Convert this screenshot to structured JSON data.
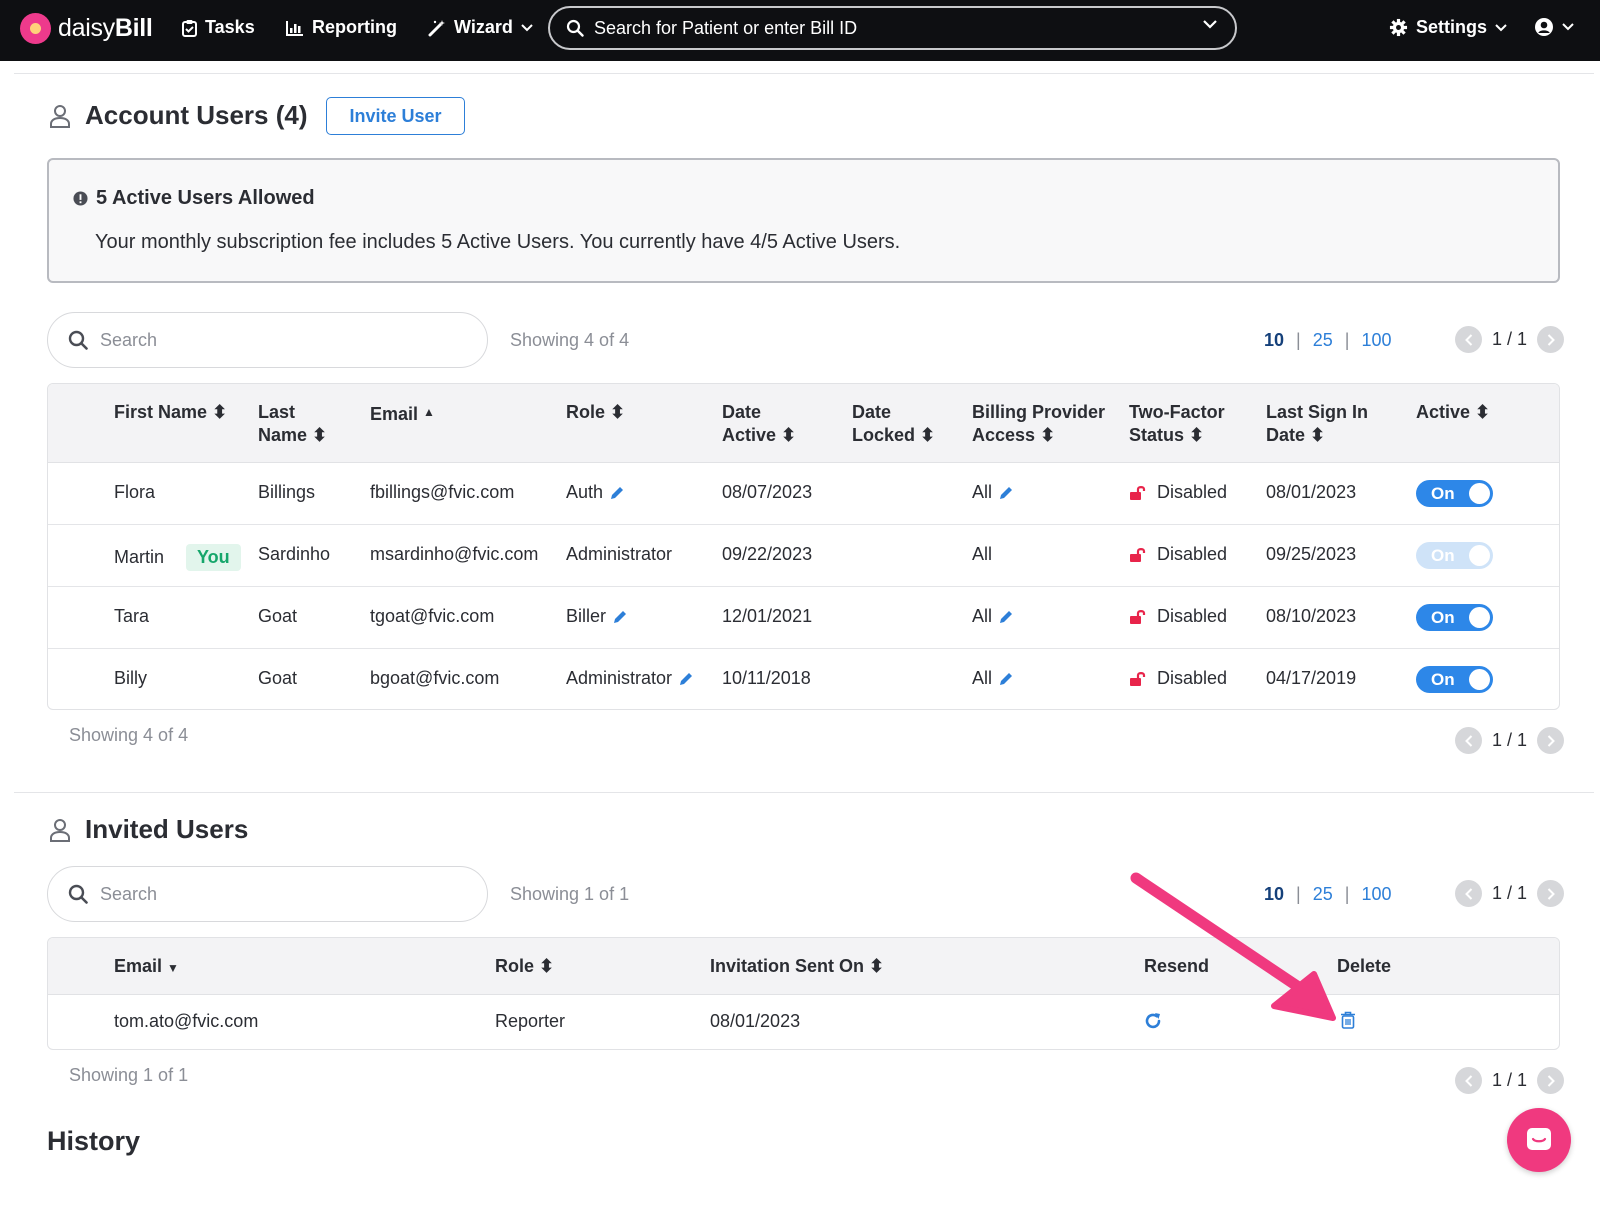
{
  "app": {
    "logo_text_light": "daisy",
    "logo_text_bold": "Bill",
    "nav": {
      "tasks": "Tasks",
      "reporting": "Reporting",
      "wizard": "Wizard",
      "settings": "Settings"
    },
    "search_placeholder": "Search for Patient or enter Bill ID"
  },
  "account_users": {
    "title": "Account Users (4)",
    "invite_label": "Invite User",
    "notice_title": "5 Active Users Allowed",
    "notice_body": "Your monthly subscription fee includes 5 Active Users. You currently have 4/5 Active Users.",
    "search_placeholder": "Search",
    "showing_top": "Showing 4 of 4",
    "showing_bottom": "Showing 4 of 4",
    "page_sizes": [
      "10",
      "25",
      "100"
    ],
    "page_sep": "|",
    "pager": "1 / 1",
    "columns": {
      "first_name": "First Name",
      "last_name_1": "Last",
      "last_name_2": "Name",
      "email": "Email",
      "role": "Role",
      "date_active_1": "Date",
      "date_active_2": "Active",
      "date_locked_1": "Date",
      "date_locked_2": "Locked",
      "billing_1": "Billing Provider",
      "billing_2": "Access",
      "twofactor_1": "Two-Factor",
      "twofactor_2": "Status",
      "lastsign_1": "Last Sign In",
      "lastsign_2": "Date",
      "active": "Active"
    },
    "you_badge": "You",
    "rows": [
      {
        "first": "Flora",
        "last": "Billings",
        "email": "fbillings@fvic.com",
        "role": "Auth",
        "date_active": "08/07/2023",
        "date_locked": "",
        "billing": "All",
        "twofactor": "Disabled",
        "last_sign_in": "08/01/2023",
        "active": "On"
      },
      {
        "first": "Martin",
        "last": "Sardinho",
        "email": "msardinho@fvic.com",
        "role": "Administrator",
        "date_active": "09/22/2023",
        "date_locked": "",
        "billing": "All",
        "twofactor": "Disabled",
        "last_sign_in": "09/25/2023",
        "active": "On"
      },
      {
        "first": "Tara",
        "last": "Goat",
        "email": "tgoat@fvic.com",
        "role": "Biller",
        "date_active": "12/01/2021",
        "date_locked": "",
        "billing": "All",
        "twofactor": "Disabled",
        "last_sign_in": "08/10/2023",
        "active": "On"
      },
      {
        "first": "Billy",
        "last": "Goat",
        "email": "bgoat@fvic.com",
        "role": "Administrator",
        "date_active": "10/11/2018",
        "date_locked": "",
        "billing": "All",
        "twofactor": "Disabled",
        "last_sign_in": "04/17/2019",
        "active": "On"
      }
    ]
  },
  "invited_users": {
    "title": "Invited Users",
    "search_placeholder": "Search",
    "showing_top": "Showing 1 of 1",
    "showing_bottom": "Showing 1 of 1",
    "page_sizes": [
      "10",
      "25",
      "100"
    ],
    "page_sep": "|",
    "pager": "1 / 1",
    "columns": {
      "email": "Email",
      "role": "Role",
      "sent_on": "Invitation Sent On",
      "resend": "Resend",
      "delete": "Delete"
    },
    "rows": [
      {
        "email": "tom.ato@fvic.com",
        "role": "Reporter",
        "sent_on": "08/01/2023"
      }
    ]
  },
  "history": {
    "title": "History"
  },
  "colors": {
    "accent_blue": "#2d7fd8",
    "topbar": "#0e0f12",
    "arrow_pink": "#f0397f",
    "you_green": "#16a66b"
  }
}
